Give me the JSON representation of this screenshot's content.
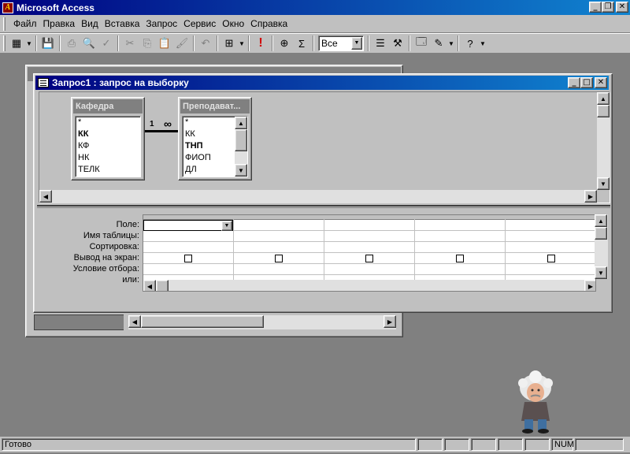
{
  "app": {
    "title": "Microsoft Access",
    "icon": "access-key-icon"
  },
  "menu": [
    "Файл",
    "Правка",
    "Вид",
    "Вставка",
    "Запрос",
    "Сервис",
    "Окно",
    "Справка"
  ],
  "toolbar": {
    "top_values": "Все",
    "icons": [
      "view-icon",
      "save-icon",
      "print-icon",
      "print-preview-icon",
      "spelling-icon",
      "cut-icon",
      "copy-icon",
      "paste-icon",
      "format-painter-icon",
      "undo-icon",
      "query-type-icon",
      "run-icon",
      "show-table-icon",
      "totals-icon",
      "properties-icon",
      "build-icon",
      "database-window-icon",
      "new-object-icon",
      "help-icon"
    ]
  },
  "query_window": {
    "title": "Запрос1 : запрос на выборку",
    "tables": [
      {
        "name": "Кафедра",
        "fields": [
          "*",
          "КК",
          "КФ",
          "НК",
          "ТЕЛК"
        ],
        "bold": [
          1
        ]
      },
      {
        "name": "Преподават...",
        "fields": [
          "*",
          "КК",
          "ТНП",
          "ФИОП",
          "ДЛ"
        ],
        "bold": [
          2
        ]
      }
    ],
    "relationship": {
      "one": "1",
      "many": "∞"
    },
    "grid_rows": [
      "Поле:",
      "Имя таблицы:",
      "Сортировка:",
      "Вывод на экран:",
      "Условие отбора:",
      "или:"
    ]
  },
  "status": {
    "text": "Готово",
    "num": "NUM"
  }
}
